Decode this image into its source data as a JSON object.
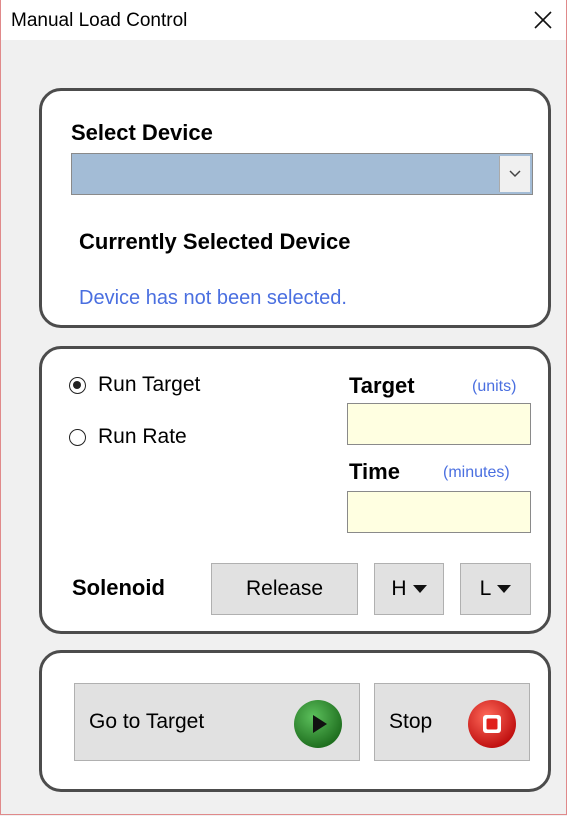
{
  "window": {
    "title": "Manual Load Control"
  },
  "device": {
    "select_label": "Select Device",
    "selected_value": "",
    "current_label": "Currently Selected Device",
    "status_text": "Device has not been selected."
  },
  "run": {
    "options": [
      {
        "label": "Run Target",
        "checked": true
      },
      {
        "label": "Run Rate",
        "checked": false
      }
    ],
    "target": {
      "label": "Target",
      "unit": "(units)",
      "value": ""
    },
    "time": {
      "label": "Time",
      "unit": "(minutes)",
      "value": ""
    }
  },
  "solenoid": {
    "label": "Solenoid",
    "release_label": "Release",
    "h_label": "H",
    "l_label": "L"
  },
  "actions": {
    "go_label": "Go to Target",
    "stop_label": "Stop"
  },
  "colors": {
    "link_blue": "#4a6fe0",
    "combo_fill": "#a3bcd6",
    "field_fill": "#ffffe1",
    "go_green": "#2e8b2e",
    "stop_red": "#e0201c",
    "window_border": "#e0898a"
  },
  "icons": {
    "close": "close-icon",
    "dropdown": "chevron-down-icon",
    "go": "play-icon",
    "stop": "stop-icon"
  }
}
